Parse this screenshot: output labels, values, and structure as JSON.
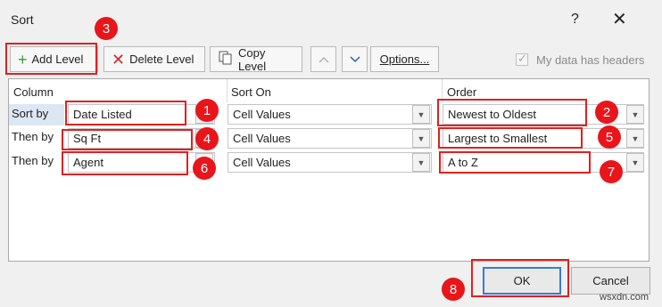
{
  "window": {
    "title": "Sort",
    "help": "?",
    "close": "✕"
  },
  "toolbar": {
    "add_level": "Add Level",
    "delete_level": "Delete Level",
    "copy_level": "Copy Level",
    "options": "Options...",
    "my_data_has_headers": "My data has headers",
    "my_data_has_headers_checked": true
  },
  "columns": {
    "column": "Column",
    "sort_on": "Sort On",
    "order": "Order"
  },
  "rows": [
    {
      "label": "Sort by",
      "column": "Date Listed",
      "sort_on": "Cell Values",
      "order": "Newest to Oldest"
    },
    {
      "label": "Then by",
      "column": "Sq Ft",
      "sort_on": "Cell Values",
      "order": "Largest to Smallest"
    },
    {
      "label": "Then by",
      "column": "Agent",
      "sort_on": "Cell Values",
      "order": "A to Z"
    }
  ],
  "buttons": {
    "ok": "OK",
    "cancel": "Cancel"
  },
  "badges": [
    "1",
    "2",
    "3",
    "4",
    "5",
    "6",
    "7",
    "8"
  ],
  "watermark": "wsxdn.com",
  "colors": {
    "highlight": "#e0201f",
    "badge": "#e8151b",
    "selected_row": "#dde7f4"
  }
}
